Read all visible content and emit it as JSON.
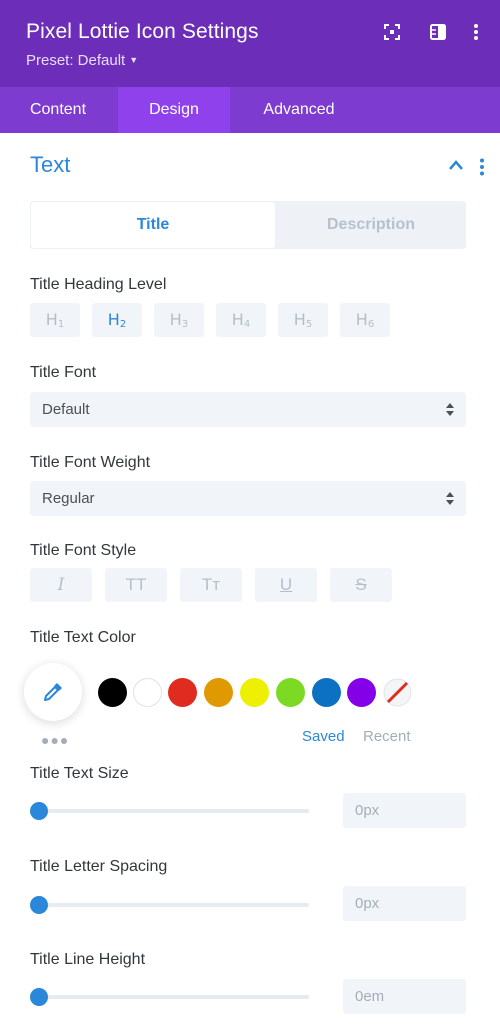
{
  "header": {
    "title": "Pixel Lottie Icon Settings",
    "preset": "Preset: Default",
    "icons": [
      "focus-icon",
      "sidebar-layout-icon",
      "more-vertical-icon"
    ]
  },
  "tabs": [
    {
      "label": "Content",
      "active": false
    },
    {
      "label": "Design",
      "active": true
    },
    {
      "label": "Advanced",
      "active": false
    }
  ],
  "section": {
    "title": "Text",
    "icons": [
      "chevron-up-icon",
      "more-vertical-icon"
    ]
  },
  "subtabs": [
    {
      "label": "Title",
      "active": true
    },
    {
      "label": "Description",
      "active": false
    }
  ],
  "heading_level": {
    "label": "Title Heading Level",
    "options": [
      {
        "letter": "H",
        "num": "1"
      },
      {
        "letter": "H",
        "num": "2"
      },
      {
        "letter": "H",
        "num": "3"
      },
      {
        "letter": "H",
        "num": "4"
      },
      {
        "letter": "H",
        "num": "5"
      },
      {
        "letter": "H",
        "num": "6"
      }
    ],
    "selected": "H2"
  },
  "font": {
    "label": "Title Font",
    "value": "Default"
  },
  "font_weight": {
    "label": "Title Font Weight",
    "value": "Regular"
  },
  "font_style": {
    "label": "Title Font Style",
    "buttons": [
      {
        "glyph": "I",
        "icon": "italic-icon"
      },
      {
        "glyph": "TT",
        "icon": "uppercase-icon"
      },
      {
        "glyph": "Tт",
        "icon": "capitalize-icon"
      },
      {
        "glyph": "U",
        "icon": "underline-icon"
      },
      {
        "glyph": "S",
        "icon": "strikethrough-icon"
      }
    ]
  },
  "text_color": {
    "label": "Title Text Color",
    "swatches": [
      "#000000",
      "#ffffff",
      "#e02b20",
      "#e09900",
      "#edf000",
      "#7cda24",
      "#0c71c3",
      "#8300e9"
    ],
    "saved_label": "Saved",
    "recent_label": "Recent",
    "accent": "#2b87da"
  },
  "text_size": {
    "label": "Title Text Size",
    "value": "0px",
    "slider_fraction": 0
  },
  "letter_spacing": {
    "label": "Title Letter Spacing",
    "value": "0px",
    "slider_fraction": 0
  },
  "line_height": {
    "label": "Title Line Height",
    "value": "0em",
    "slider_fraction": 0
  }
}
